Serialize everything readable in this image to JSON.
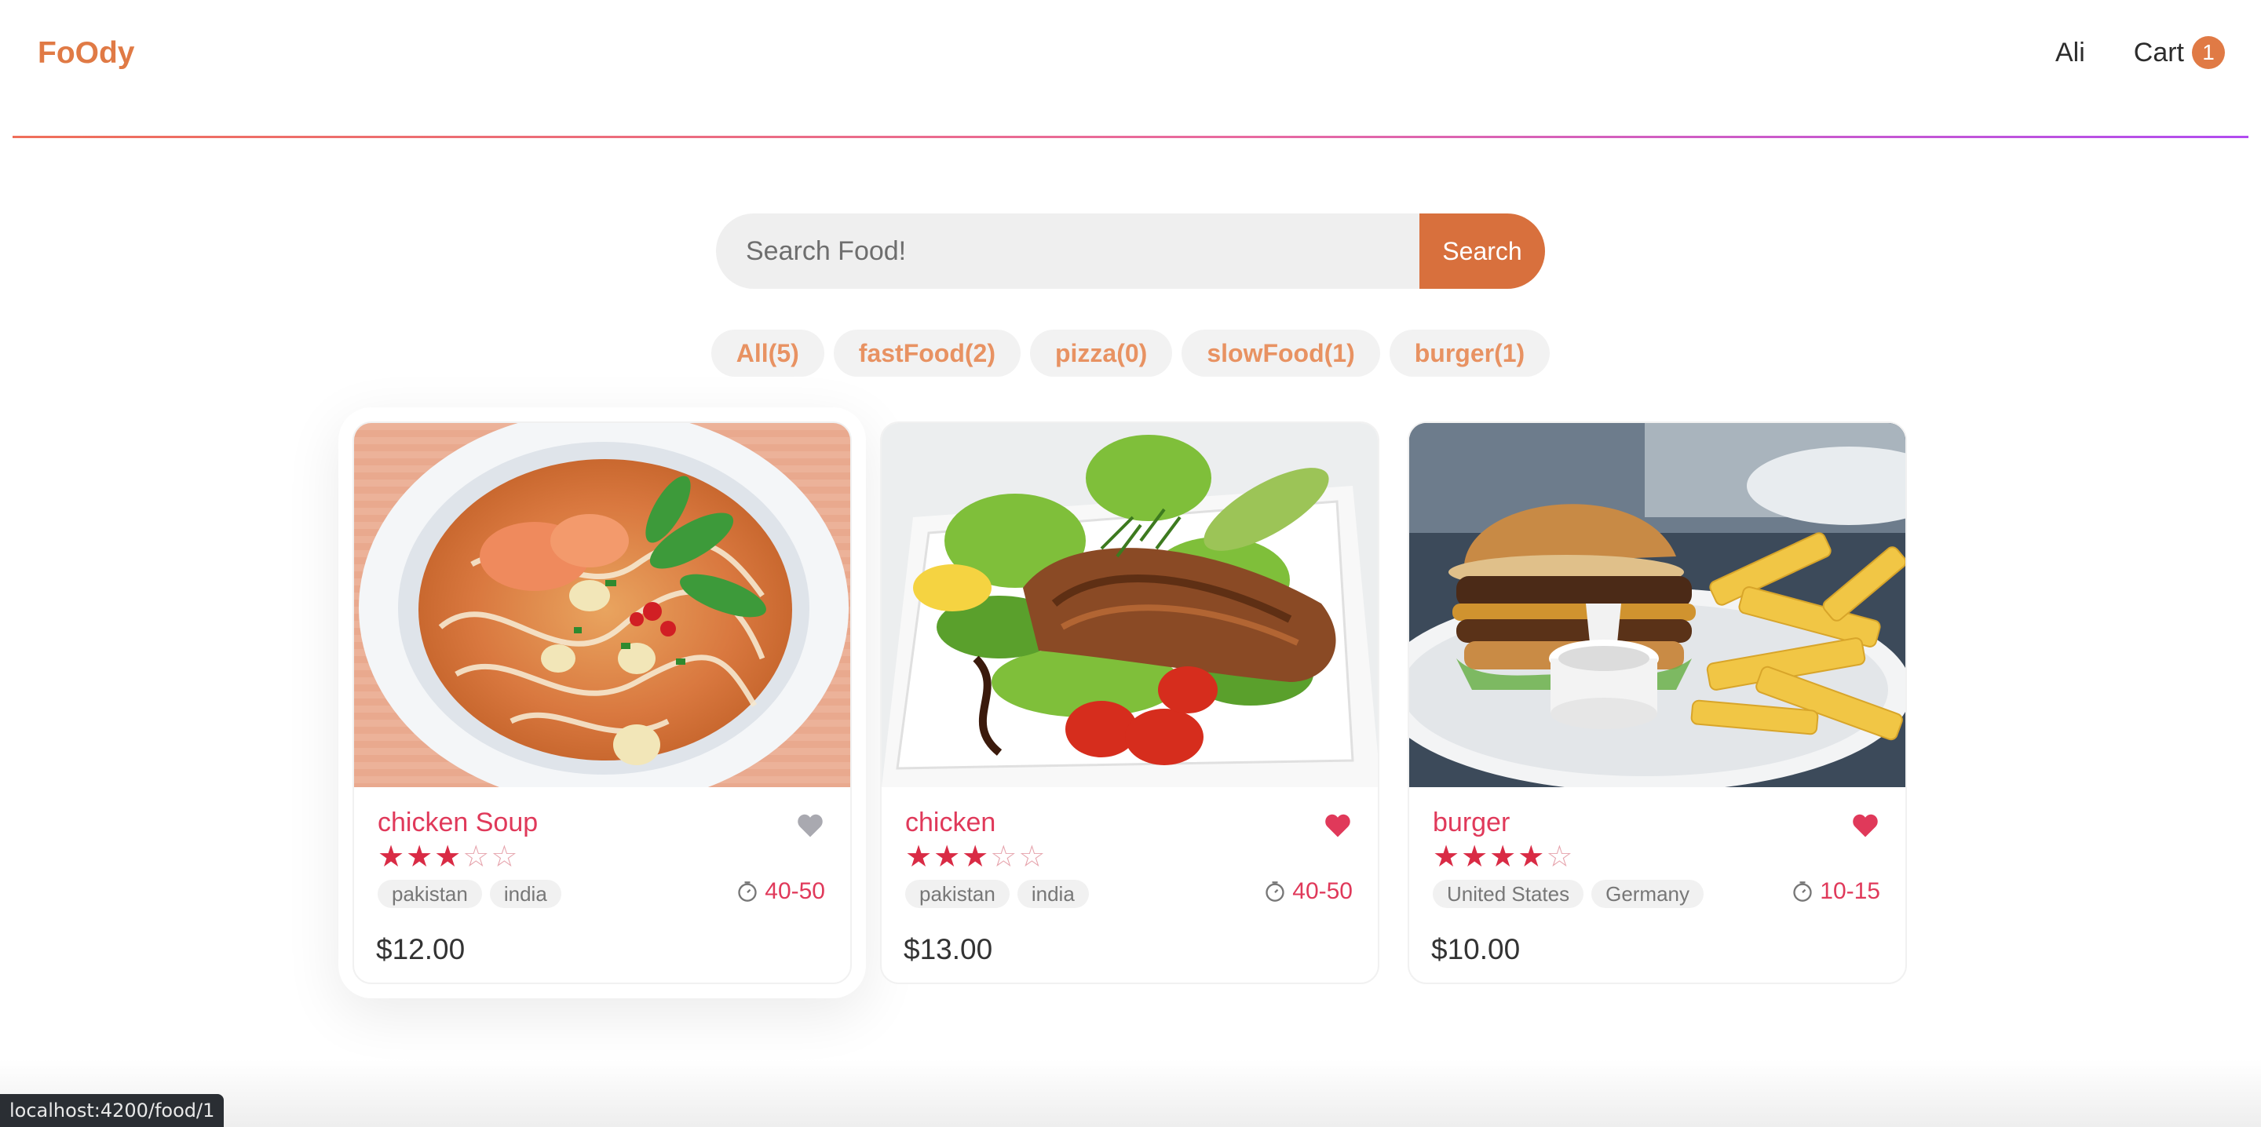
{
  "header": {
    "brand": "FoOdy",
    "user_name": "Ali",
    "cart_label": "Cart",
    "cart_count": "1"
  },
  "search": {
    "placeholder": "Search Food!",
    "button_label": "Search"
  },
  "tags": [
    {
      "label": "All(5)"
    },
    {
      "label": "fastFood(2)"
    },
    {
      "label": "pizza(0)"
    },
    {
      "label": "slowFood(1)"
    },
    {
      "label": "burger(1)"
    }
  ],
  "foods": [
    {
      "name": "chicken Soup",
      "favorite": false,
      "stars": 3,
      "origins": [
        "pakistan",
        "india"
      ],
      "cook_time": "40-50",
      "price": "$12.00",
      "image": "soup-photo"
    },
    {
      "name": "chicken",
      "favorite": true,
      "stars": 3,
      "origins": [
        "pakistan",
        "india"
      ],
      "cook_time": "40-50",
      "price": "$13.00",
      "image": "grilled-fish-salad-photo"
    },
    {
      "name": "burger",
      "favorite": true,
      "stars": 4,
      "origins": [
        "United States",
        "Germany"
      ],
      "cook_time": "10-15",
      "price": "$10.00",
      "image": "burger-fries-photo"
    }
  ],
  "status_url": "localhost:4200/food/1",
  "colors": {
    "brand": "#e07a45",
    "accent": "#d8703d",
    "name": "#e0395a",
    "favorite_on": "#e0395a",
    "favorite_off": "#a9a9b0"
  }
}
